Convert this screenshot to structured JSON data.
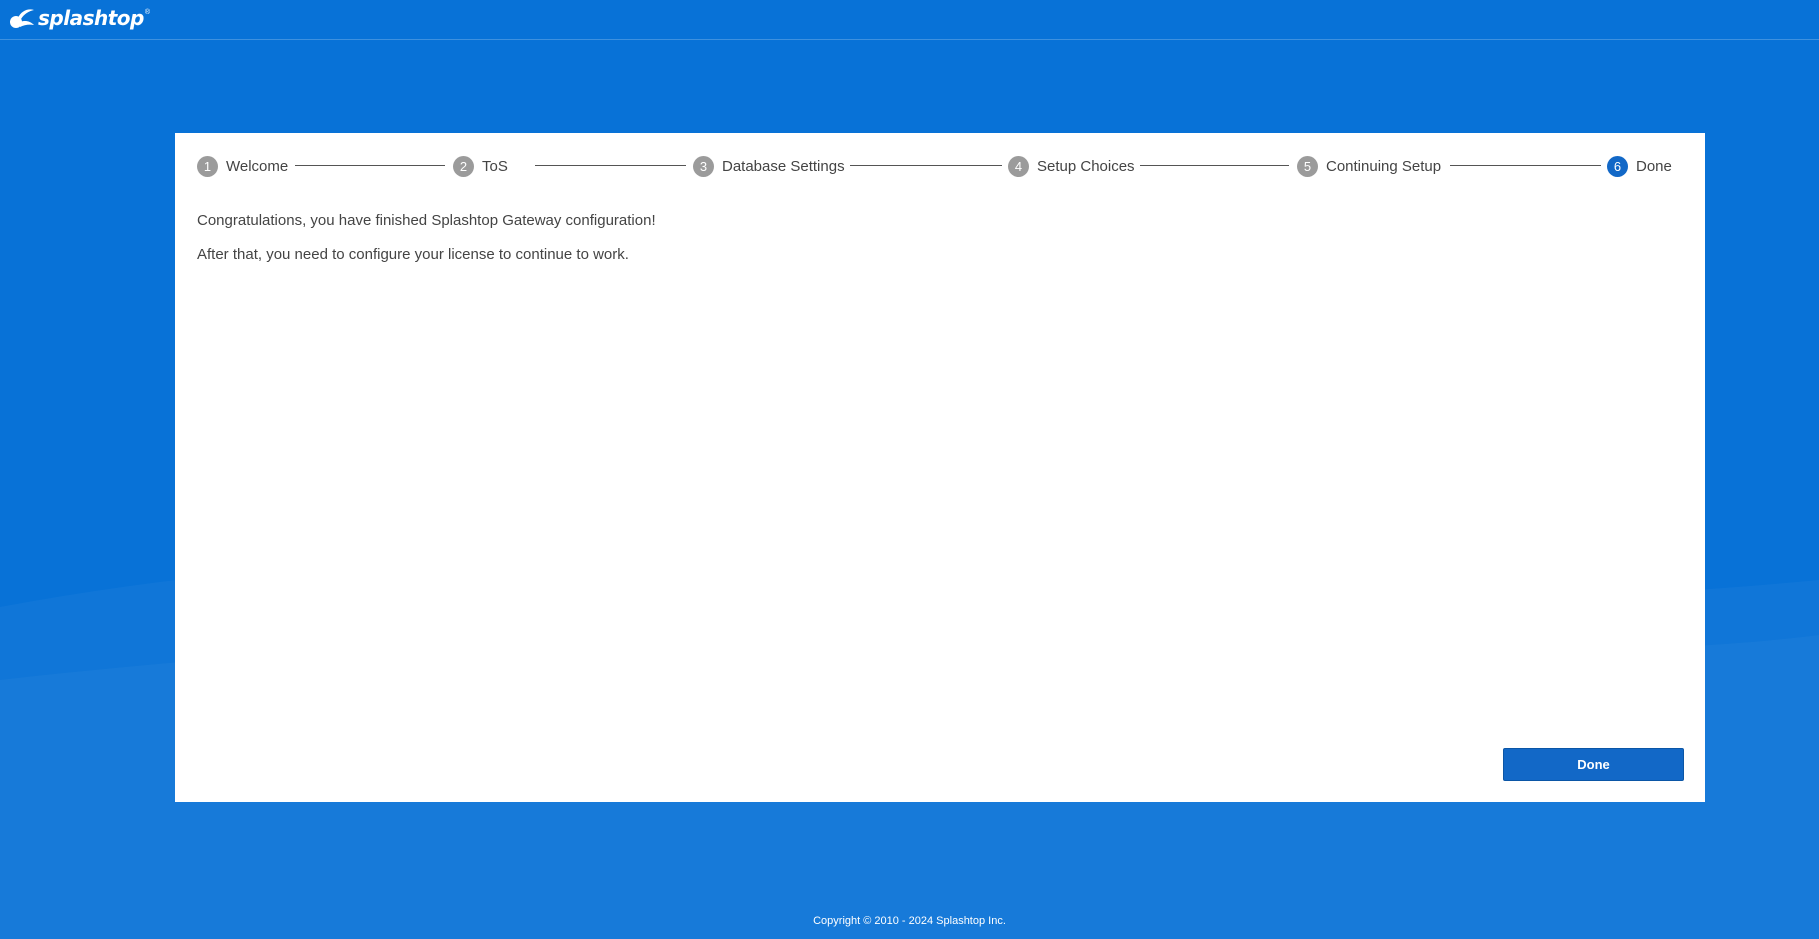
{
  "header": {
    "logo_text": "splashtop",
    "logo_tm": "®"
  },
  "stepper": {
    "steps": [
      {
        "number": "1",
        "label": "Welcome",
        "state": "complete"
      },
      {
        "number": "2",
        "label": "ToS",
        "state": "complete"
      },
      {
        "number": "3",
        "label": "Database Settings",
        "state": "complete"
      },
      {
        "number": "4",
        "label": "Setup Choices",
        "state": "complete"
      },
      {
        "number": "5",
        "label": "Continuing Setup",
        "state": "complete"
      },
      {
        "number": "6",
        "label": "Done",
        "state": "active"
      }
    ]
  },
  "content": {
    "message_1": "Congratulations, you have finished Splashtop Gateway configuration!",
    "message_2": "After that, you need to configure your license to continue to work."
  },
  "actions": {
    "done_label": "Done"
  },
  "footer": {
    "copyright": "Copyright © 2010 - 2024 Splashtop Inc."
  },
  "colors": {
    "background": "#0872d7",
    "accent": "#1268c7",
    "step_inactive": "#9b9b9b",
    "text": "#444444"
  }
}
